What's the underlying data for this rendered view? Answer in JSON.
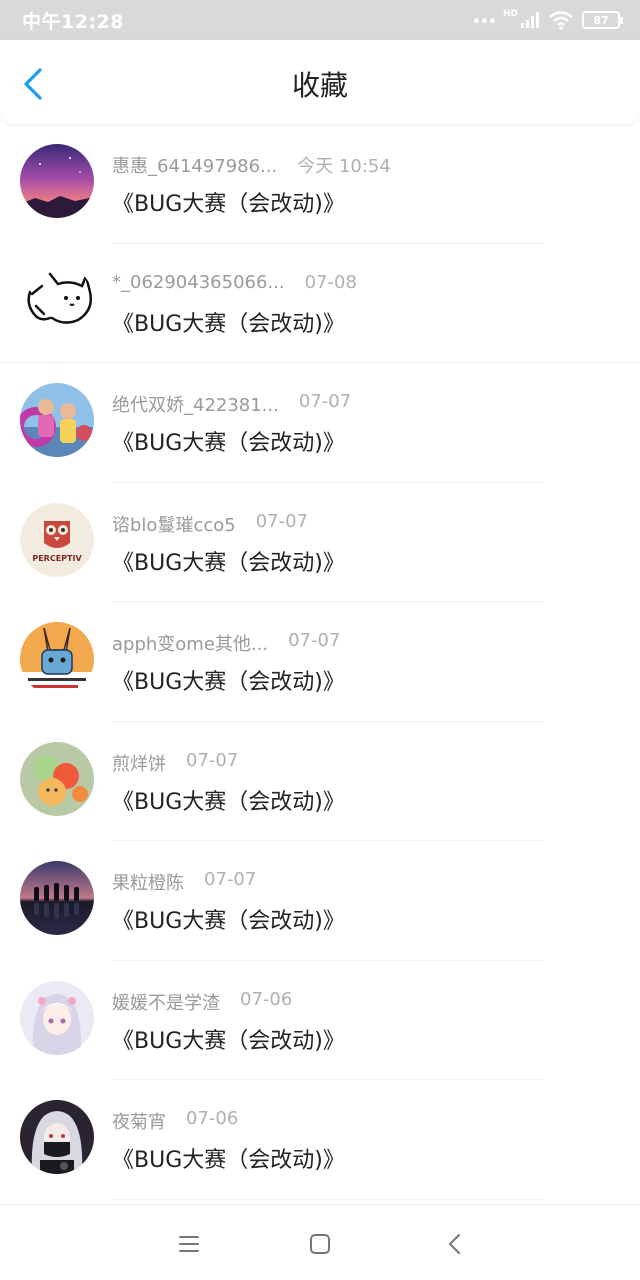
{
  "status_bar": {
    "time": "中午12:28",
    "network": "HD",
    "battery": "87"
  },
  "header": {
    "title": "收藏",
    "back_icon": "chevron-left-icon"
  },
  "items": [
    {
      "name": "惠惠_641497986...",
      "time": "今天 10:54",
      "title": "《BUG大赛（会改动)》",
      "avatar": "sunset-sky-avatar"
    },
    {
      "name": "*_062904365066...",
      "time": "07-08",
      "title": "《BUG大赛（会改动)》",
      "avatar": "doodle-cat-avatar"
    },
    {
      "name": "绝代双娇_422381...",
      "time": "07-07",
      "title": "《BUG大赛（会改动)》",
      "avatar": "two-girls-photo-avatar"
    },
    {
      "name": "谘blo鬘璀cco5",
      "time": "07-07",
      "title": "《BUG大赛（会改动)》",
      "avatar": "perceptiv-owl-logo-avatar",
      "avatar_text": "PERCEPTIV"
    },
    {
      "name": "apph变ome其他...",
      "time": "07-07",
      "title": "《BUG大赛（会改动)》",
      "avatar": "cartoon-rabbit-avatar"
    },
    {
      "name": "煎烊饼",
      "time": "07-07",
      "title": "《BUG大赛（会改动)》",
      "avatar": "balloons-avatar"
    },
    {
      "name": "果粒橙陈",
      "time": "07-07",
      "title": "《BUG大赛（会改动)》",
      "avatar": "silhouettes-sunset-avatar"
    },
    {
      "name": "媛媛不是学渣",
      "time": "07-06",
      "title": "《BUG大赛（会改动)》",
      "avatar": "anime-girl-white-hair-avatar"
    },
    {
      "name": "夜菊宵",
      "time": "07-06",
      "title": "《BUG大赛（会改动)》",
      "avatar": "anime-girl-mask-avatar"
    }
  ],
  "nav_bar": {
    "menu_icon": "menu-icon",
    "home_icon": "home-square-icon",
    "back_icon": "back-triangle-icon"
  },
  "colors": {
    "accent": "#1a9bf0",
    "status_bar_bg": "#d9d9d9",
    "meta_text": "#9a9a9a",
    "title_text": "#222222"
  }
}
